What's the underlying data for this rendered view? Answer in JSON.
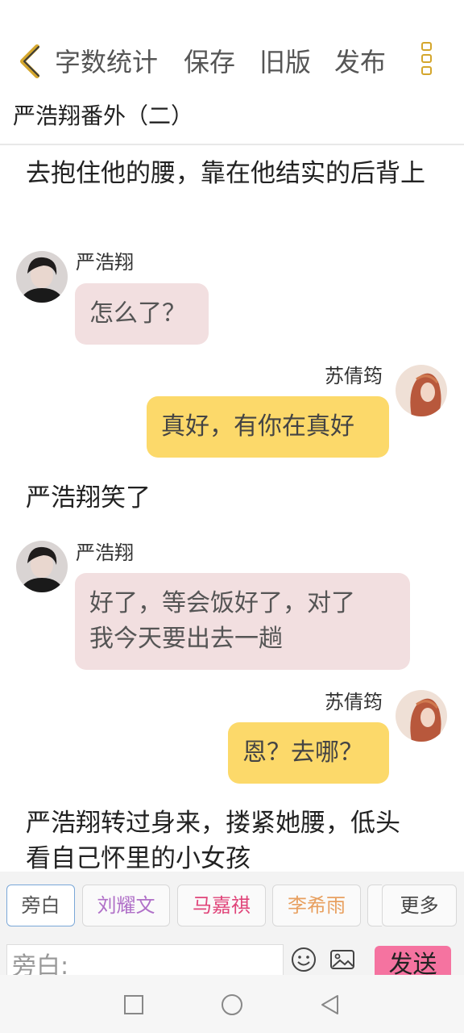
{
  "toolbar": {
    "back_icon": "chevron-left-icon",
    "word_count_label": "字数统计",
    "save_label": "保存",
    "old_version_label": "旧版",
    "publish_label": "发布",
    "more_icon": "vertical-dots-icon",
    "accent_color": "#d4a62c"
  },
  "story": {
    "title": "严浩翔番外（二）"
  },
  "messages": {
    "n1": "去抱住他的腰，靠在他结实的后背上",
    "m1_speaker": "严浩翔",
    "m1_text": "怎么了？",
    "m2_speaker": "苏倩筠",
    "m2_text": "真好，有你在真好",
    "n2": "严浩翔笑了",
    "m3_speaker": "严浩翔",
    "m3_line1": "好了，等会饭好了，对了",
    "m3_line2": "我今天要出去一趟",
    "m4_speaker": "苏倩筠",
    "m4_text": "恩？去哪？",
    "n3_line1": "严浩翔转过身来，搂紧她腰，低头",
    "n3_line2": "看自己怀里的小女孩"
  },
  "colors": {
    "left_bubble": "#f2dfe0",
    "right_bubble": "#fcd96a",
    "send_button": "#f573a0"
  },
  "composer": {
    "chips": [
      "旁白",
      "刘耀文",
      "马嘉祺",
      "李希雨",
      "更多"
    ],
    "chip_colors": [
      "#555555",
      "#b070c8",
      "#e0457a",
      "#e8a060",
      "#444444"
    ],
    "input_placeholder": "旁白:",
    "emoji_icon": "smiley-icon",
    "image_icon": "image-icon",
    "send_label": "发送"
  },
  "system_nav": {
    "icons": [
      "square-icon",
      "circle-icon",
      "triangle-back-icon"
    ]
  }
}
